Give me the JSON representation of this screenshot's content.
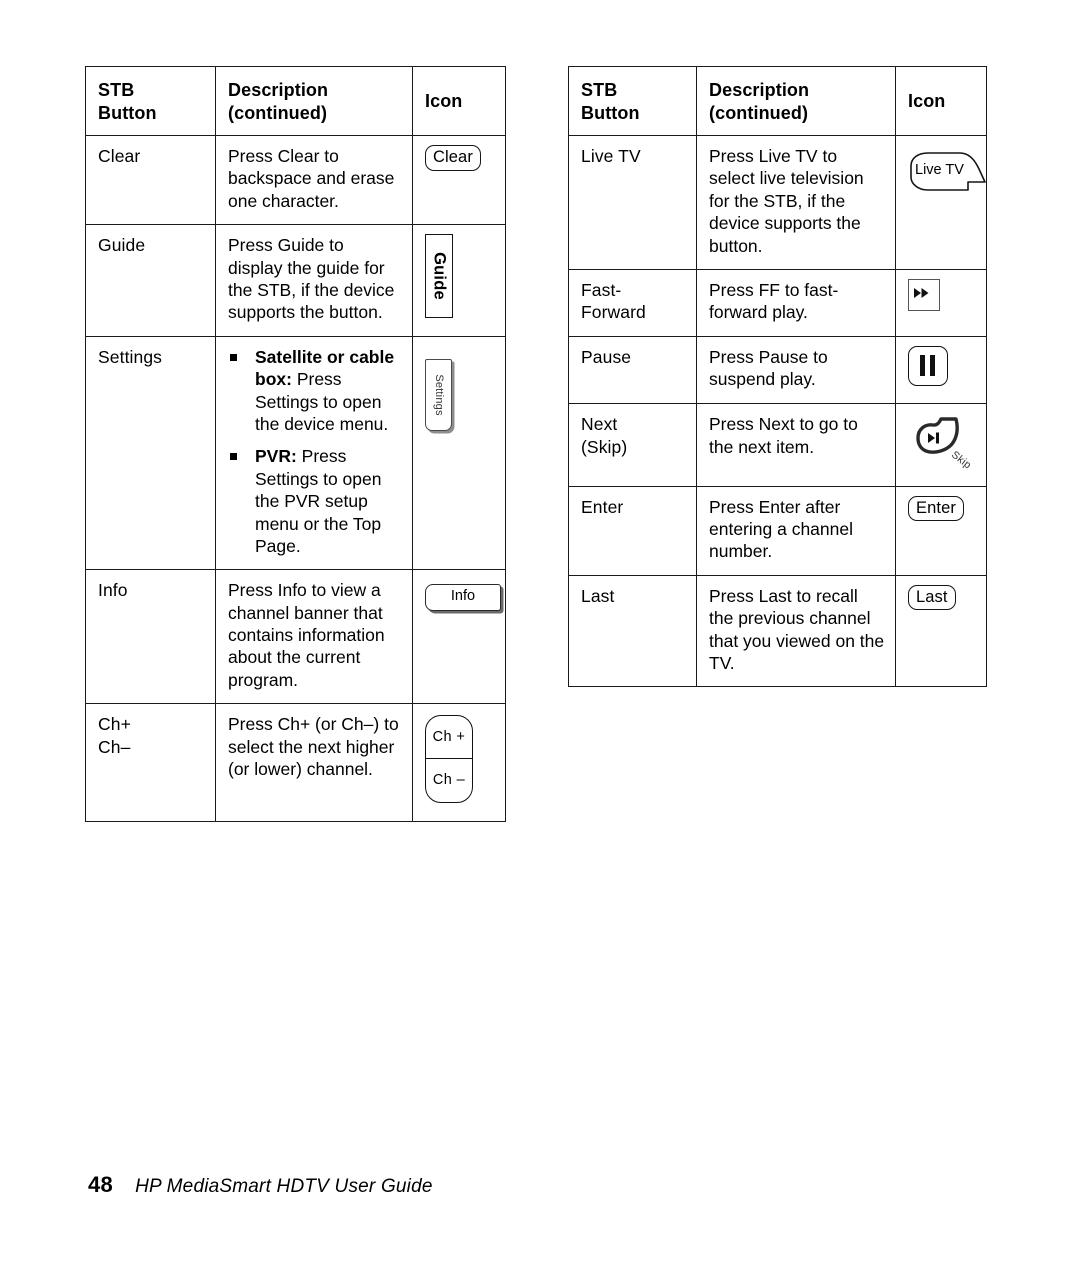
{
  "page": {
    "number": "48",
    "footer_title": "HP MediaSmart HDTV User Guide"
  },
  "tables": {
    "left": {
      "headers": {
        "col1_line1": "STB",
        "col1_line2": "Button",
        "col2_line1": "Description",
        "col2_line2": "(continued)",
        "col3": "Icon"
      },
      "rows": [
        {
          "button": "Clear",
          "description": "Press Clear to backspace and erase one character.",
          "icon_name": "clear-key-icon",
          "icon_label": "Clear"
        },
        {
          "button": "Guide",
          "description": "Press Guide to display the guide for the STB, if the device supports the button.",
          "icon_name": "guide-key-icon",
          "icon_label": "Guide"
        },
        {
          "button": "Settings",
          "bullets": [
            {
              "strong": "Satellite or cable box:",
              "rest": " Press Settings to open the device menu."
            },
            {
              "strong": "PVR:",
              "rest": " Press Settings to open the PVR setup menu or the Top Page."
            }
          ],
          "icon_name": "settings-key-icon",
          "icon_label": "Settings"
        },
        {
          "button": "Info",
          "description": "Press Info to view a channel banner that contains information about the current program.",
          "icon_name": "info-key-icon",
          "icon_label": "Info"
        },
        {
          "button_line1": "Ch+",
          "button_line2": "Ch–",
          "description": "Press Ch+ (or Ch–) to select the next higher (or lower) channel.",
          "icon_name": "channel-rocker-icon",
          "icon_label_top": "Ch +",
          "icon_label_bottom": "Ch –"
        }
      ]
    },
    "right": {
      "headers": {
        "col1_line1": "STB",
        "col1_line2": "Button",
        "col2_line1": "Description",
        "col2_line2": "(continued)",
        "col3": "Icon"
      },
      "rows": [
        {
          "button": "Live TV",
          "description": "Press Live TV to select live television for the STB, if the device supports the button.",
          "icon_name": "live-tv-key-icon",
          "icon_label": "Live TV"
        },
        {
          "button_line1": "Fast-",
          "button_line2": "Forward",
          "description": "Press FF to fast-forward play.",
          "icon_name": "fast-forward-icon",
          "icon_label": ""
        },
        {
          "button": "Pause",
          "description": "Press Pause to suspend play.",
          "icon_name": "pause-icon",
          "icon_label": ""
        },
        {
          "button_line1": "Next",
          "button_line2": "(Skip)",
          "description": "Press Next to go to the next item.",
          "icon_name": "skip-next-icon",
          "icon_label": "Skip"
        },
        {
          "button": "Enter",
          "description": "Press Enter after entering a channel number.",
          "icon_name": "enter-key-icon",
          "icon_label": "Enter"
        },
        {
          "button": "Last",
          "description": "Press Last to recall the previous channel that you viewed on the TV.",
          "icon_name": "last-key-icon",
          "icon_label": "Last"
        }
      ]
    }
  },
  "colors": {
    "text": "#000000",
    "border": "#1a1a1a",
    "key_shadow": "#8e8e8e",
    "background": "#ffffff"
  }
}
